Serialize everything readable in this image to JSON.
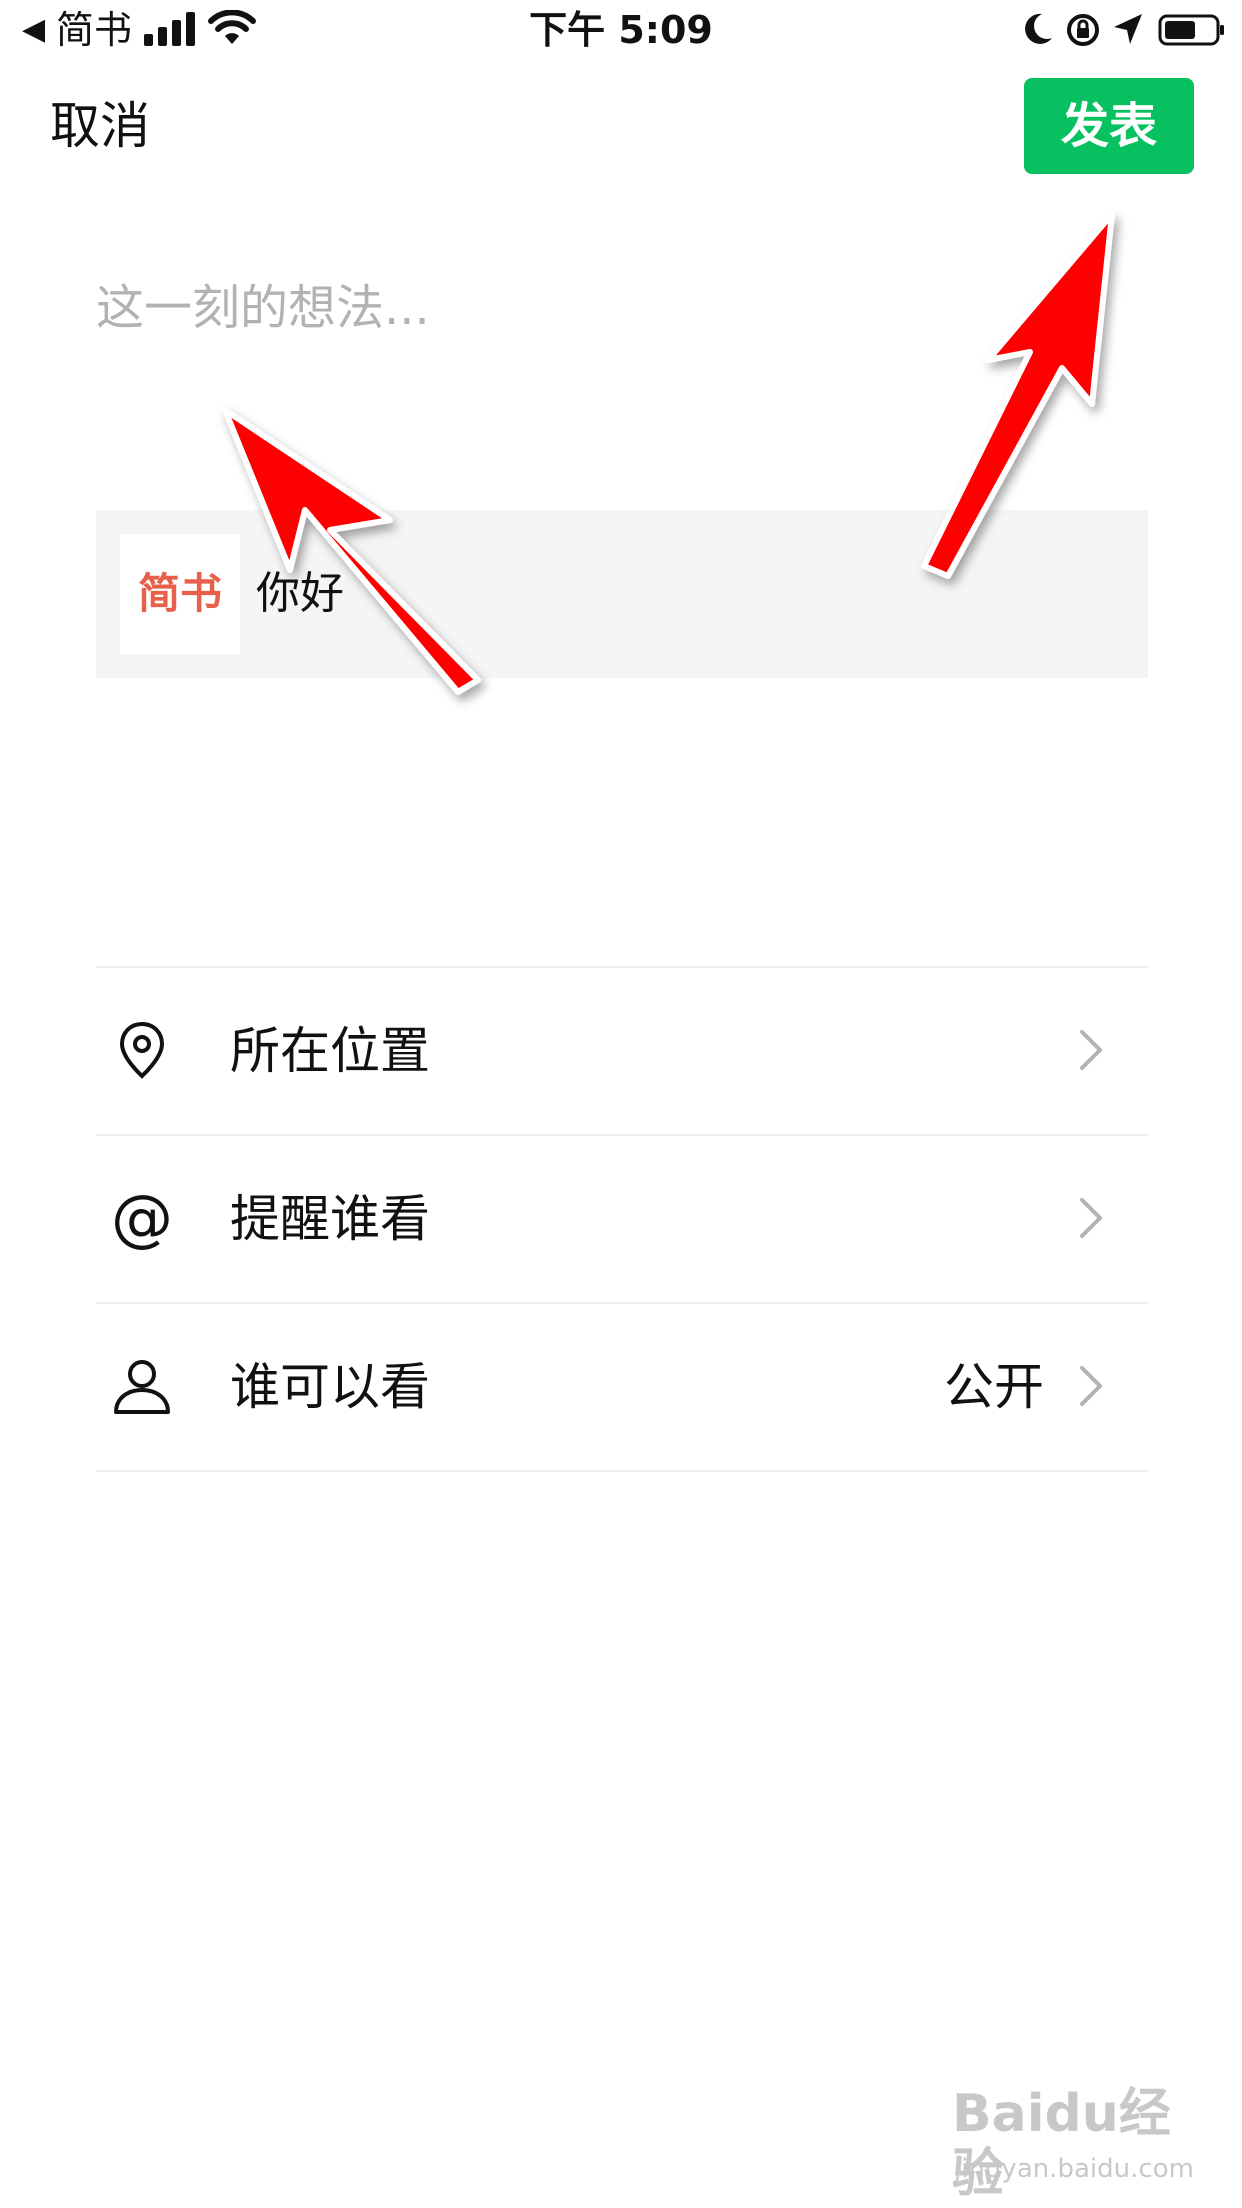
{
  "status_bar": {
    "back_app": "简书",
    "time": "下午 5:09",
    "back_glyph": "◀"
  },
  "nav": {
    "cancel_label": "取消",
    "publish_label": "发表",
    "publish_color": "#07c160"
  },
  "composer": {
    "placeholder": "这一刻的想法...",
    "value": ""
  },
  "link_card": {
    "source": "简书",
    "title": "你好",
    "source_color": "#e8604c"
  },
  "options": [
    {
      "icon": "location-pin-icon",
      "label": "所在位置",
      "value": ""
    },
    {
      "icon": "at-icon",
      "label": "提醒谁看",
      "value": "",
      "glyph": "@"
    },
    {
      "icon": "person-icon",
      "label": "谁可以看",
      "value": "公开"
    }
  ],
  "watermark": {
    "logo": "Baidu经验",
    "url": "jingyan.baidu.com"
  }
}
